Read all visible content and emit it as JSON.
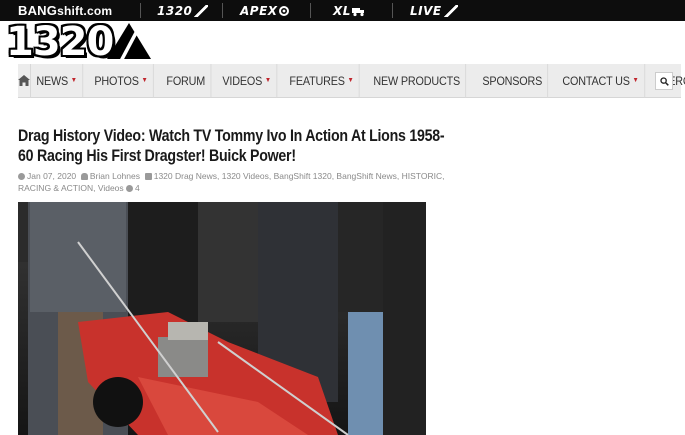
{
  "network_bar": {
    "brand_main": "BANG",
    "brand_tail": "shift.com",
    "links": [
      {
        "label": "1320",
        "icon": "slash-icon"
      },
      {
        "label": "APEX",
        "icon": "gear-icon"
      },
      {
        "label": "XL",
        "icon": "truck-icon"
      },
      {
        "label": "LIVE",
        "icon": "slash-icon"
      }
    ]
  },
  "logo": {
    "text": "1320"
  },
  "nav": {
    "items": [
      {
        "label": "NEWS",
        "dropdown": true
      },
      {
        "label": "PHOTOS",
        "dropdown": true
      },
      {
        "label": "FORUM",
        "dropdown": false
      },
      {
        "label": "VIDEOS",
        "dropdown": true
      },
      {
        "label": "FEATURES",
        "dropdown": true
      },
      {
        "label": "NEW PRODUCTS",
        "dropdown": false
      },
      {
        "label": "SPONSORS",
        "dropdown": false
      },
      {
        "label": "CONTACT US",
        "dropdown": true
      },
      {
        "label": "MERCH",
        "dropdown": false
      }
    ],
    "caret": "▼"
  },
  "article": {
    "title": "Drag History Video: Watch TV Tommy Ivo In Action At Lions 1958-60 Racing His First Dragster! Buick Power!",
    "date": "Jan 07, 2020",
    "author": "Brian Lohnes",
    "categories": "1320 Drag News, 1320 Videos, BangShift 1320, BangShift News, HISTORIC, RACING & ACTION, Videos",
    "comments": "4"
  },
  "colors": {
    "topbar": "#0d0d0d",
    "nav_bg": "#ececec",
    "accent_red": "#c0262d"
  }
}
